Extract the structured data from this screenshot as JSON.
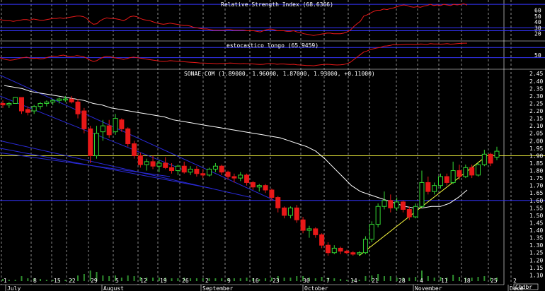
{
  "colors": {
    "background": "#000000",
    "grid_vertical": "#c8c8c8",
    "band_line": "#3535ff",
    "up_candle": "#33d633",
    "down_candle": "#e81818",
    "indicator_line": "#e81818",
    "moving_average": "#ffffff",
    "trendline": "#ffff40",
    "resistance": "#ffff40",
    "channel": "#2a2ad8",
    "volume": "#2f8f2f"
  },
  "chart_data": [
    {
      "type": "line",
      "title": "Relative Strength Index (68.6366)",
      "yticks": [
        "60",
        "50",
        "40",
        "30",
        "20"
      ],
      "ylim": [
        10,
        75
      ],
      "bands": [
        70,
        30,
        25
      ],
      "series": [
        {
          "values": [
            44,
            43,
            42,
            42,
            41,
            42,
            43,
            44,
            44,
            43,
            45,
            44,
            43,
            43,
            44,
            45,
            46,
            46,
            47,
            46,
            47,
            48,
            49,
            50,
            50,
            49,
            46,
            40,
            36,
            37,
            42,
            45,
            47,
            46,
            46,
            45,
            44,
            42,
            45,
            49,
            50,
            49,
            46,
            44,
            43,
            42,
            40,
            38,
            37,
            36,
            37,
            38,
            37,
            36,
            35,
            34,
            34,
            33,
            31,
            30,
            29,
            28,
            28,
            27,
            26,
            26,
            26,
            26,
            27,
            27,
            26,
            26,
            26,
            26,
            25,
            25,
            25,
            24,
            23,
            25,
            27,
            28,
            27,
            25,
            25,
            25,
            24,
            24,
            25,
            23,
            22,
            20,
            19,
            18,
            17,
            18,
            19,
            20,
            21,
            21,
            20,
            20,
            20,
            21,
            23,
            26,
            32,
            37,
            41,
            50,
            52,
            55,
            58,
            60,
            60,
            62,
            61,
            63,
            64,
            66,
            68,
            69,
            68,
            66,
            65,
            66,
            65,
            67,
            68,
            70,
            68,
            69,
            68,
            70,
            69,
            68,
            70,
            69,
            70,
            71,
            68.6
          ]
        }
      ]
    },
    {
      "type": "line",
      "title": "estocastico longo (65.9459)",
      "yticks": [
        "50"
      ],
      "ylim": [
        0,
        100
      ],
      "bands": [
        80,
        40
      ],
      "series": [
        {
          "values": [
            40,
            35,
            32,
            30,
            31,
            34,
            38,
            40,
            42,
            38,
            37,
            38,
            35,
            36,
            40,
            44,
            46,
            45,
            48,
            50,
            46,
            44,
            45,
            48,
            46,
            44,
            38,
            30,
            25,
            28,
            36,
            42,
            45,
            44,
            40,
            38,
            36,
            33,
            36,
            40,
            42,
            40,
            38,
            36,
            34,
            32,
            30,
            28,
            26,
            25,
            26,
            28,
            27,
            26,
            25,
            24,
            23,
            22,
            21,
            20,
            19,
            19,
            18,
            18,
            17,
            16,
            17,
            17,
            18,
            19,
            18,
            17,
            16,
            17,
            16,
            16,
            15,
            14,
            13,
            14,
            16,
            17,
            16,
            14,
            15,
            15,
            14,
            13,
            14,
            12,
            11,
            10,
            9,
            9,
            8,
            10,
            12,
            13,
            14,
            13,
            12,
            11,
            12,
            13,
            16,
            22,
            32,
            42,
            52,
            62,
            66,
            72,
            75,
            78,
            80,
            85,
            86,
            88,
            92,
            90,
            91,
            92,
            93,
            93,
            92,
            92,
            94,
            93,
            92,
            95,
            94,
            94,
            93,
            94,
            95,
            93,
            94,
            95,
            96,
            97,
            97
          ]
        }
      ]
    },
    {
      "type": "bar",
      "title": "SONAE.COM (1.89000, 1.96000, 1.87000, 1.93000, +0.11000)",
      "ylabels": [
        "2.45",
        "2.40",
        "2.35",
        "2.30",
        "2.25",
        "2.20",
        "2.15",
        "2.10",
        "2.05",
        "2.00",
        "1.95",
        "1.90",
        "1.85",
        "1.80",
        "1.75",
        "1.70",
        "1.65",
        "1.60",
        "1.55",
        "1.50",
        "1.45",
        "1.40",
        "1.35",
        "1.30",
        "1.25",
        "1.20",
        "1.15",
        "1.10"
      ],
      "ylim": [
        1.05,
        2.47
      ],
      "xlabels": [
        "1",
        "8",
        "15",
        "22",
        "29",
        "5",
        "12",
        "19",
        "26",
        "2",
        "9",
        "16",
        "23",
        "30",
        "7",
        "14",
        "21",
        "28",
        "4",
        "11",
        "18",
        "25",
        "2"
      ],
      "months": [
        "July",
        "August",
        "September",
        "October",
        "November",
        "Dece"
      ],
      "x_axis_box": "Cbdbr",
      "resistance": 1.9,
      "support": 1.6,
      "candles": [
        [
          2.25,
          2.27,
          2.22,
          2.24
        ],
        [
          2.24,
          2.26,
          2.22,
          2.25
        ],
        [
          2.25,
          2.29,
          2.25,
          2.29
        ],
        [
          2.29,
          2.29,
          2.18,
          2.2
        ],
        [
          2.21,
          2.23,
          2.17,
          2.19
        ],
        [
          2.2,
          2.24,
          2.18,
          2.23
        ],
        [
          2.23,
          2.26,
          2.21,
          2.25
        ],
        [
          2.25,
          2.27,
          2.23,
          2.26
        ],
        [
          2.26,
          2.28,
          2.24,
          2.27
        ],
        [
          2.27,
          2.29,
          2.25,
          2.28
        ],
        [
          2.28,
          2.3,
          2.26,
          2.28
        ],
        [
          2.28,
          2.3,
          2.25,
          2.26
        ],
        [
          2.26,
          2.28,
          2.15,
          2.18
        ],
        [
          2.2,
          2.22,
          2.05,
          2.08
        ],
        [
          2.08,
          2.1,
          1.85,
          1.9
        ],
        [
          1.9,
          2.1,
          1.88,
          2.05
        ],
        [
          2.06,
          2.14,
          2.0,
          2.1
        ],
        [
          2.1,
          2.14,
          2.02,
          2.04
        ],
        [
          2.06,
          2.18,
          2.04,
          2.15
        ],
        [
          2.14,
          2.15,
          2.06,
          2.08
        ],
        [
          2.08,
          2.09,
          1.96,
          1.98
        ],
        [
          1.98,
          2.0,
          1.88,
          1.9
        ],
        [
          1.9,
          1.92,
          1.82,
          1.84
        ],
        [
          1.84,
          1.88,
          1.8,
          1.86
        ],
        [
          1.86,
          1.9,
          1.81,
          1.83
        ],
        [
          1.83,
          1.87,
          1.79,
          1.85
        ],
        [
          1.85,
          1.89,
          1.81,
          1.82
        ],
        [
          1.82,
          1.85,
          1.78,
          1.8
        ],
        [
          1.8,
          1.84,
          1.77,
          1.83
        ],
        [
          1.83,
          1.86,
          1.78,
          1.79
        ],
        [
          1.79,
          1.83,
          1.77,
          1.81
        ],
        [
          1.81,
          1.83,
          1.76,
          1.78
        ],
        [
          1.78,
          1.81,
          1.75,
          1.77
        ],
        [
          1.77,
          1.82,
          1.76,
          1.81
        ],
        [
          1.81,
          1.85,
          1.79,
          1.83
        ],
        [
          1.83,
          1.84,
          1.77,
          1.79
        ],
        [
          1.79,
          1.8,
          1.74,
          1.76
        ],
        [
          1.76,
          1.78,
          1.72,
          1.75
        ],
        [
          1.75,
          1.79,
          1.73,
          1.77
        ],
        [
          1.77,
          1.78,
          1.7,
          1.72
        ],
        [
          1.72,
          1.73,
          1.67,
          1.69
        ],
        [
          1.69,
          1.71,
          1.66,
          1.7
        ],
        [
          1.7,
          1.71,
          1.65,
          1.67
        ],
        [
          1.67,
          1.68,
          1.6,
          1.62
        ],
        [
          1.62,
          1.63,
          1.52,
          1.55
        ],
        [
          1.55,
          1.56,
          1.48,
          1.5
        ],
        [
          1.5,
          1.56,
          1.48,
          1.55
        ],
        [
          1.55,
          1.57,
          1.45,
          1.47
        ],
        [
          1.47,
          1.49,
          1.38,
          1.4
        ],
        [
          1.4,
          1.43,
          1.35,
          1.41
        ],
        [
          1.41,
          1.42,
          1.35,
          1.37
        ],
        [
          1.37,
          1.38,
          1.28,
          1.3
        ],
        [
          1.3,
          1.32,
          1.23,
          1.25
        ],
        [
          1.25,
          1.3,
          1.24,
          1.28
        ],
        [
          1.28,
          1.29,
          1.24,
          1.26
        ],
        [
          1.26,
          1.27,
          1.24,
          1.25
        ],
        [
          1.25,
          1.26,
          1.23,
          1.24
        ],
        [
          1.24,
          1.26,
          1.23,
          1.25
        ],
        [
          1.25,
          1.36,
          1.24,
          1.34
        ],
        [
          1.34,
          1.46,
          1.32,
          1.44
        ],
        [
          1.44,
          1.58,
          1.42,
          1.56
        ],
        [
          1.56,
          1.66,
          1.54,
          1.6
        ],
        [
          1.6,
          1.64,
          1.52,
          1.55
        ],
        [
          1.55,
          1.62,
          1.53,
          1.59
        ],
        [
          1.59,
          1.6,
          1.52,
          1.54
        ],
        [
          1.54,
          1.56,
          1.47,
          1.49
        ],
        [
          1.49,
          1.58,
          1.48,
          1.56
        ],
        [
          1.56,
          1.8,
          1.55,
          1.72
        ],
        [
          1.72,
          1.76,
          1.64,
          1.66
        ],
        [
          1.66,
          1.72,
          1.64,
          1.7
        ],
        [
          1.7,
          1.78,
          1.68,
          1.76
        ],
        [
          1.76,
          1.78,
          1.7,
          1.72
        ],
        [
          1.72,
          1.86,
          1.71,
          1.8
        ],
        [
          1.8,
          1.84,
          1.74,
          1.76
        ],
        [
          1.76,
          1.84,
          1.75,
          1.82
        ],
        [
          1.82,
          1.84,
          1.75,
          1.77
        ],
        [
          1.77,
          1.86,
          1.76,
          1.84
        ],
        [
          1.84,
          1.94,
          1.83,
          1.91
        ],
        [
          1.91,
          1.92,
          1.83,
          1.85
        ],
        [
          1.89,
          1.96,
          1.87,
          1.93
        ]
      ]
    }
  ]
}
